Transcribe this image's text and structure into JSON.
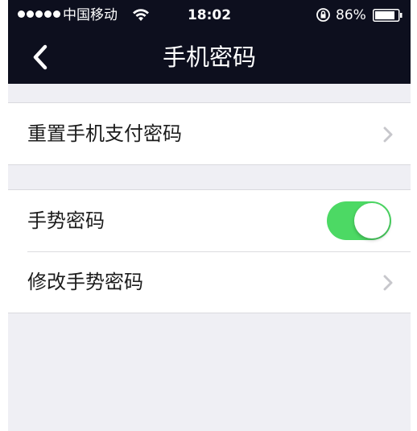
{
  "status_bar": {
    "carrier": "中国移动",
    "time": "18:02",
    "battery_percent": "86%"
  },
  "nav": {
    "title": "手机密码"
  },
  "groups": [
    {
      "items": [
        {
          "label": "重置手机支付密码",
          "accessory": "chevron"
        }
      ]
    },
    {
      "items": [
        {
          "label": "手势密码",
          "accessory": "toggle",
          "toggle_on": true
        },
        {
          "label": "修改手势密码",
          "accessory": "chevron"
        }
      ]
    }
  ],
  "colors": {
    "nav_background": "#0d0f1e",
    "toggle_on": "#4cd964",
    "page_background": "#efeff4"
  }
}
